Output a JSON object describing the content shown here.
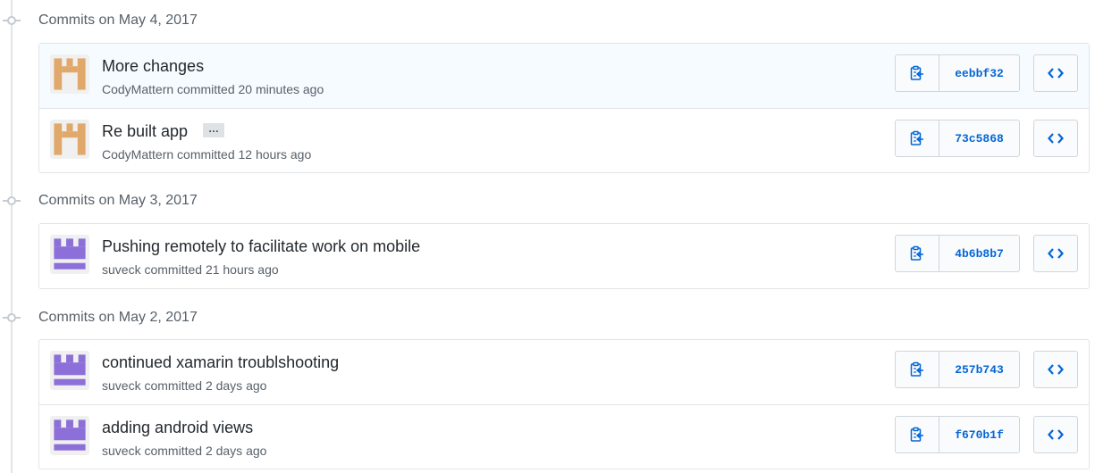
{
  "groups": [
    {
      "title": "Commits on May 4, 2017",
      "commits": [
        {
          "message": "More changes",
          "author": "CodyMattern",
          "verb": "committed",
          "time": "20 minutes ago",
          "sha": "eebbf32",
          "avatar_color": "#e0a86a",
          "highlighted": true,
          "has_ellipsis": false
        },
        {
          "message": "Re built app",
          "author": "CodyMattern",
          "verb": "committed",
          "time": "12 hours ago",
          "sha": "73c5868",
          "avatar_color": "#e0a86a",
          "highlighted": false,
          "has_ellipsis": true
        }
      ]
    },
    {
      "title": "Commits on May 3, 2017",
      "commits": [
        {
          "message": "Pushing remotely to facilitate work on mobile",
          "author": "suveck",
          "verb": "committed",
          "time": "21 hours ago",
          "sha": "4b6b8b7",
          "avatar_color": "#8c6fd8",
          "highlighted": false,
          "has_ellipsis": false
        }
      ]
    },
    {
      "title": "Commits on May 2, 2017",
      "commits": [
        {
          "message": "continued xamarin troublshooting",
          "author": "suveck",
          "verb": "committed",
          "time": "2 days ago",
          "sha": "257b743",
          "avatar_color": "#8c6fd8",
          "highlighted": false,
          "has_ellipsis": false
        },
        {
          "message": "adding android views",
          "author": "suveck",
          "verb": "committed",
          "time": "2 days ago",
          "sha": "f670b1f",
          "avatar_color": "#8c6fd8",
          "highlighted": false,
          "has_ellipsis": false
        }
      ]
    }
  ],
  "ellipsis_label": "…",
  "colors": {
    "link": "#0366d6",
    "text_muted": "#586069",
    "border": "#e1e4e8",
    "highlight_bg": "#f6fbff"
  },
  "icons": {
    "copy": "clippy-icon",
    "browse": "code-icon",
    "node": "git-commit-icon"
  }
}
